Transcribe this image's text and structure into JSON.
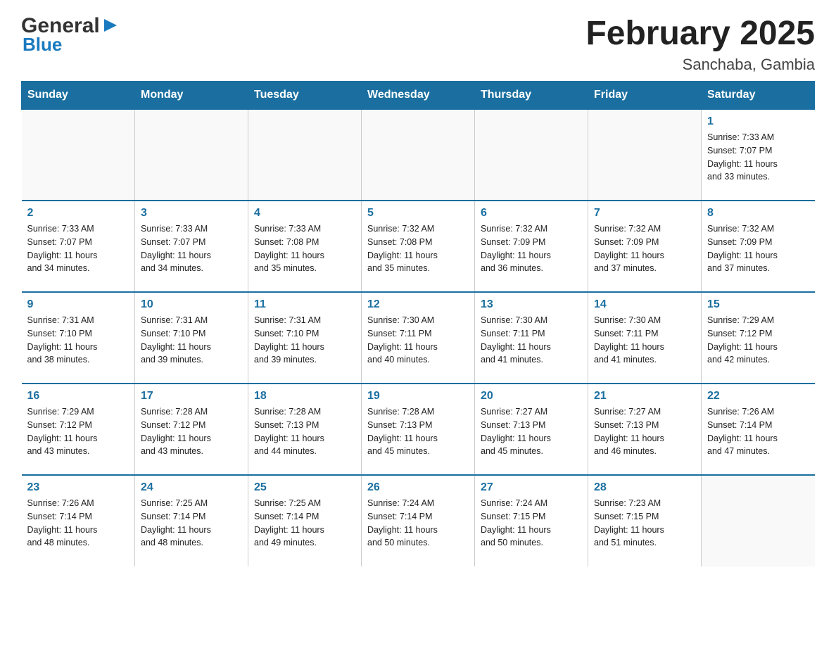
{
  "logo": {
    "general": "General",
    "blue": "Blue",
    "triangle": "▶"
  },
  "title": "February 2025",
  "subtitle": "Sanchaba, Gambia",
  "header": {
    "days": [
      "Sunday",
      "Monday",
      "Tuesday",
      "Wednesday",
      "Thursday",
      "Friday",
      "Saturday"
    ]
  },
  "weeks": [
    [
      {
        "day": "",
        "info": ""
      },
      {
        "day": "",
        "info": ""
      },
      {
        "day": "",
        "info": ""
      },
      {
        "day": "",
        "info": ""
      },
      {
        "day": "",
        "info": ""
      },
      {
        "day": "",
        "info": ""
      },
      {
        "day": "1",
        "info": "Sunrise: 7:33 AM\nSunset: 7:07 PM\nDaylight: 11 hours\nand 33 minutes."
      }
    ],
    [
      {
        "day": "2",
        "info": "Sunrise: 7:33 AM\nSunset: 7:07 PM\nDaylight: 11 hours\nand 34 minutes."
      },
      {
        "day": "3",
        "info": "Sunrise: 7:33 AM\nSunset: 7:07 PM\nDaylight: 11 hours\nand 34 minutes."
      },
      {
        "day": "4",
        "info": "Sunrise: 7:33 AM\nSunset: 7:08 PM\nDaylight: 11 hours\nand 35 minutes."
      },
      {
        "day": "5",
        "info": "Sunrise: 7:32 AM\nSunset: 7:08 PM\nDaylight: 11 hours\nand 35 minutes."
      },
      {
        "day": "6",
        "info": "Sunrise: 7:32 AM\nSunset: 7:09 PM\nDaylight: 11 hours\nand 36 minutes."
      },
      {
        "day": "7",
        "info": "Sunrise: 7:32 AM\nSunset: 7:09 PM\nDaylight: 11 hours\nand 37 minutes."
      },
      {
        "day": "8",
        "info": "Sunrise: 7:32 AM\nSunset: 7:09 PM\nDaylight: 11 hours\nand 37 minutes."
      }
    ],
    [
      {
        "day": "9",
        "info": "Sunrise: 7:31 AM\nSunset: 7:10 PM\nDaylight: 11 hours\nand 38 minutes."
      },
      {
        "day": "10",
        "info": "Sunrise: 7:31 AM\nSunset: 7:10 PM\nDaylight: 11 hours\nand 39 minutes."
      },
      {
        "day": "11",
        "info": "Sunrise: 7:31 AM\nSunset: 7:10 PM\nDaylight: 11 hours\nand 39 minutes."
      },
      {
        "day": "12",
        "info": "Sunrise: 7:30 AM\nSunset: 7:11 PM\nDaylight: 11 hours\nand 40 minutes."
      },
      {
        "day": "13",
        "info": "Sunrise: 7:30 AM\nSunset: 7:11 PM\nDaylight: 11 hours\nand 41 minutes."
      },
      {
        "day": "14",
        "info": "Sunrise: 7:30 AM\nSunset: 7:11 PM\nDaylight: 11 hours\nand 41 minutes."
      },
      {
        "day": "15",
        "info": "Sunrise: 7:29 AM\nSunset: 7:12 PM\nDaylight: 11 hours\nand 42 minutes."
      }
    ],
    [
      {
        "day": "16",
        "info": "Sunrise: 7:29 AM\nSunset: 7:12 PM\nDaylight: 11 hours\nand 43 minutes."
      },
      {
        "day": "17",
        "info": "Sunrise: 7:28 AM\nSunset: 7:12 PM\nDaylight: 11 hours\nand 43 minutes."
      },
      {
        "day": "18",
        "info": "Sunrise: 7:28 AM\nSunset: 7:13 PM\nDaylight: 11 hours\nand 44 minutes."
      },
      {
        "day": "19",
        "info": "Sunrise: 7:28 AM\nSunset: 7:13 PM\nDaylight: 11 hours\nand 45 minutes."
      },
      {
        "day": "20",
        "info": "Sunrise: 7:27 AM\nSunset: 7:13 PM\nDaylight: 11 hours\nand 45 minutes."
      },
      {
        "day": "21",
        "info": "Sunrise: 7:27 AM\nSunset: 7:13 PM\nDaylight: 11 hours\nand 46 minutes."
      },
      {
        "day": "22",
        "info": "Sunrise: 7:26 AM\nSunset: 7:14 PM\nDaylight: 11 hours\nand 47 minutes."
      }
    ],
    [
      {
        "day": "23",
        "info": "Sunrise: 7:26 AM\nSunset: 7:14 PM\nDaylight: 11 hours\nand 48 minutes."
      },
      {
        "day": "24",
        "info": "Sunrise: 7:25 AM\nSunset: 7:14 PM\nDaylight: 11 hours\nand 48 minutes."
      },
      {
        "day": "25",
        "info": "Sunrise: 7:25 AM\nSunset: 7:14 PM\nDaylight: 11 hours\nand 49 minutes."
      },
      {
        "day": "26",
        "info": "Sunrise: 7:24 AM\nSunset: 7:14 PM\nDaylight: 11 hours\nand 50 minutes."
      },
      {
        "day": "27",
        "info": "Sunrise: 7:24 AM\nSunset: 7:15 PM\nDaylight: 11 hours\nand 50 minutes."
      },
      {
        "day": "28",
        "info": "Sunrise: 7:23 AM\nSunset: 7:15 PM\nDaylight: 11 hours\nand 51 minutes."
      },
      {
        "day": "",
        "info": ""
      }
    ]
  ]
}
